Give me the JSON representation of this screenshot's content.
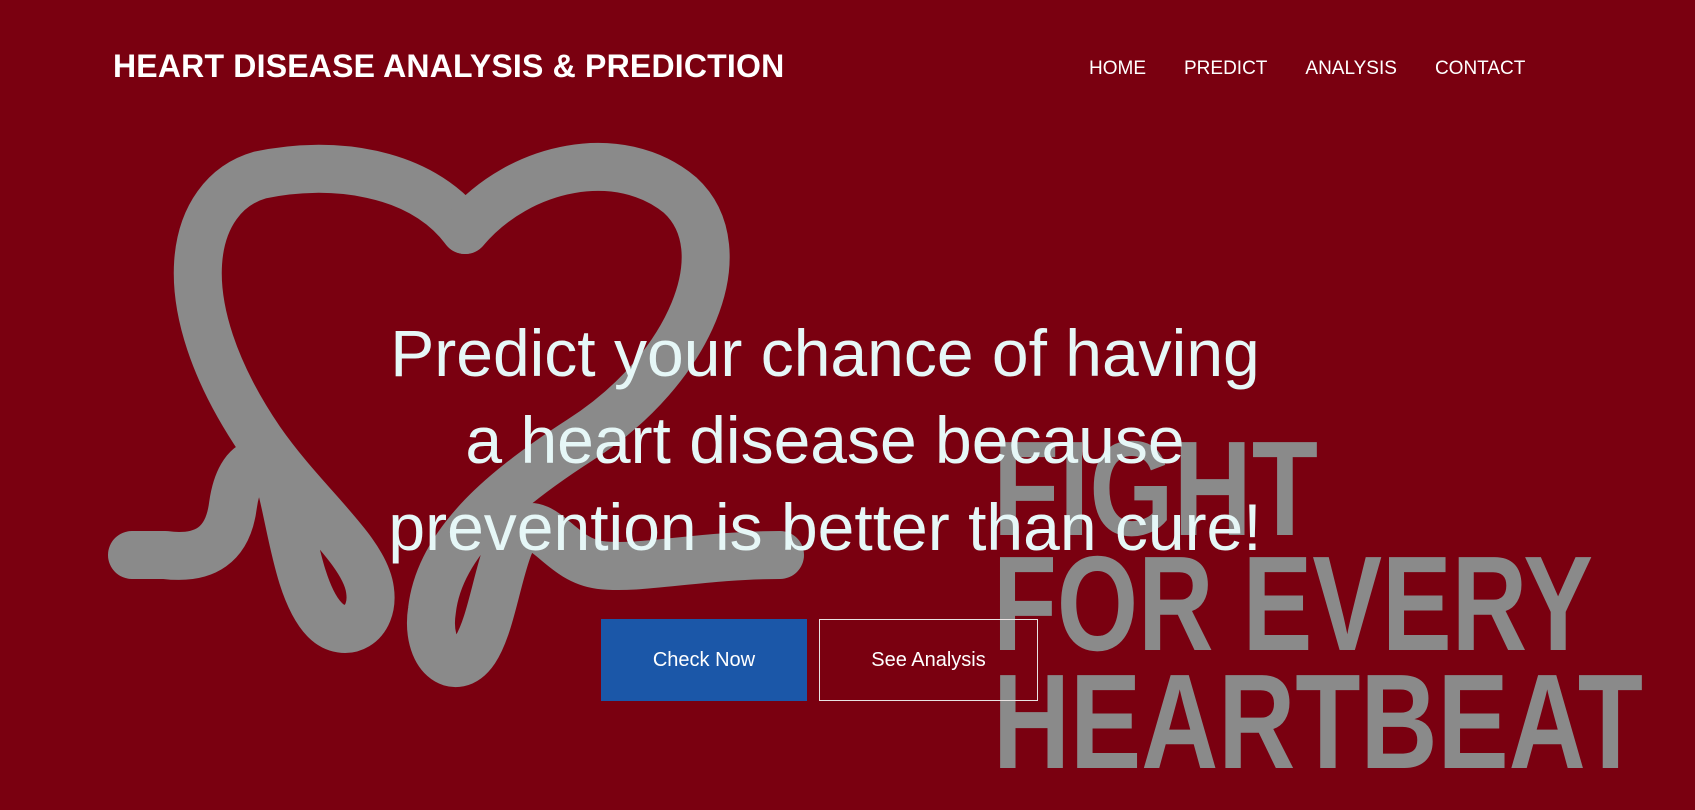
{
  "header": {
    "brand": "HEART DISEASE ANALYSIS & PREDICTION",
    "nav": [
      {
        "label": "HOME"
      },
      {
        "label": "PREDICT"
      },
      {
        "label": "ANALYSIS"
      },
      {
        "label": "CONTACT"
      }
    ]
  },
  "hero": {
    "headline_lines": [
      "Predict your chance of having",
      "a heart disease because",
      "prevention is better than cure!"
    ],
    "primary_button": "Check Now",
    "secondary_button": "See Analysis"
  },
  "background": {
    "slogan_lines": [
      "FIGHT",
      "FOR EVERY",
      "HEARTBEAT"
    ],
    "icon": "heart-pulse-logo",
    "colors": {
      "overlay": "#7a0010",
      "graphic": "#8a8a8a"
    }
  },
  "colors": {
    "headline": "#e6f7f7",
    "primary_button_bg": "#1b57a8",
    "outline_border": "#e9e3e3",
    "text": "#ffffff"
  }
}
